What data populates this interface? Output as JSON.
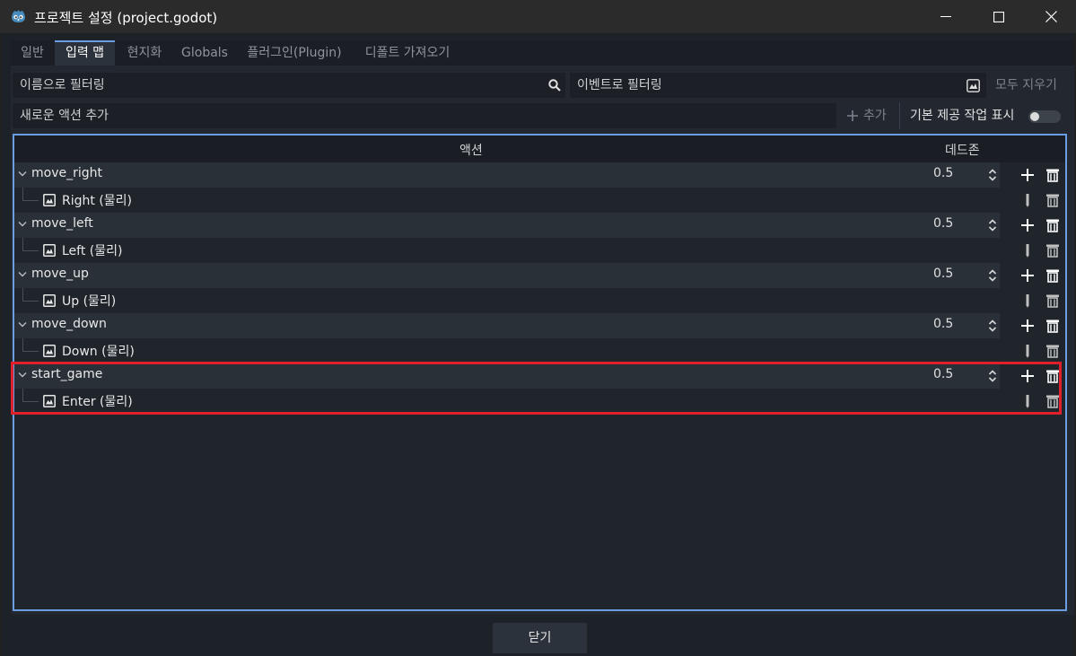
{
  "window": {
    "title": "프로젝트 설정 (project.godot)",
    "app_icon": "godot-icon",
    "controls": [
      "minimize-icon",
      "maximize-icon",
      "close-icon"
    ]
  },
  "tabs": [
    {
      "label": "일반",
      "active": false
    },
    {
      "label": "입력 맵",
      "active": true
    },
    {
      "label": "현지화",
      "active": false
    },
    {
      "label": "Globals",
      "active": false
    },
    {
      "label": "플러그인(Plugin)",
      "active": false
    },
    {
      "label": "디폴트 가져오기",
      "active": false
    }
  ],
  "filters": {
    "name_placeholder": "이름으로 필터링",
    "event_placeholder": "이벤트로 필터링",
    "clear_all_label": "모두 지우기"
  },
  "add_action": {
    "placeholder": "새로운 액션 추가",
    "add_label": "추가",
    "show_builtin_label": "기본 제공 작업 표시",
    "show_builtin_enabled": false
  },
  "tree": {
    "header_action": "액션",
    "header_deadzone": "데드존",
    "actions": [
      {
        "name": "move_right",
        "deadzone": "0.5",
        "event": "Right (물리)"
      },
      {
        "name": "move_left",
        "deadzone": "0.5",
        "event": "Left (물리)"
      },
      {
        "name": "move_up",
        "deadzone": "0.5",
        "event": "Up (물리)"
      },
      {
        "name": "move_down",
        "deadzone": "0.5",
        "event": "Down (물리)"
      },
      {
        "name": "start_game",
        "deadzone": "0.5",
        "event": "Enter (물리)"
      }
    ]
  },
  "footer": {
    "close_label": "닫기"
  },
  "colors": {
    "accent": "#6a9de2",
    "highlight": "#e0202a"
  }
}
